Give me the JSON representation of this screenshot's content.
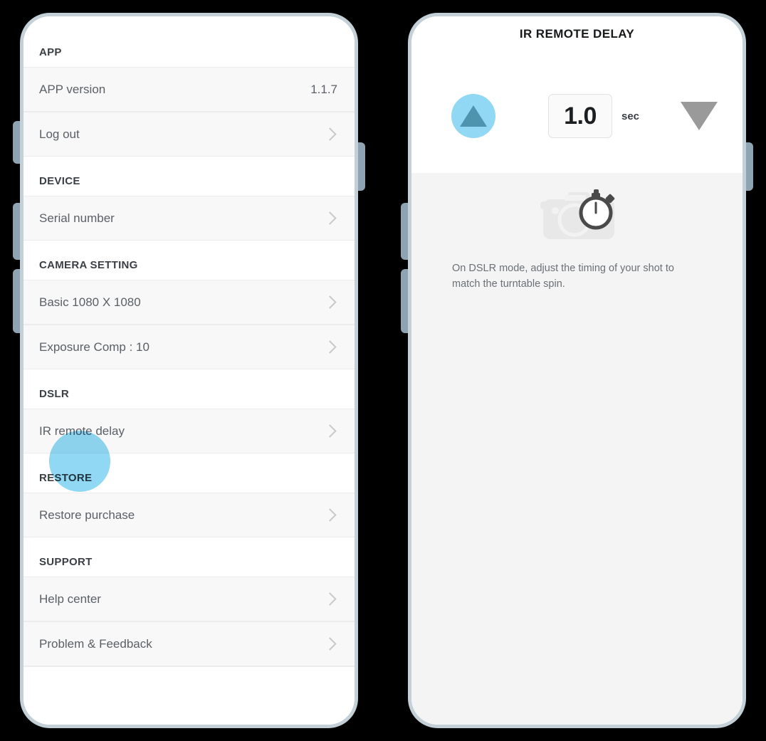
{
  "left_screen": {
    "sections": [
      {
        "header": "APP",
        "rows": [
          {
            "label": "APP version",
            "value": "1.1.7",
            "chevron": false
          },
          {
            "label": "Log out",
            "value": "",
            "chevron": true
          }
        ]
      },
      {
        "header": "DEVICE",
        "rows": [
          {
            "label": "Serial number",
            "value": "",
            "chevron": true
          }
        ]
      },
      {
        "header": "CAMERA SETTING",
        "rows": [
          {
            "label": "Basic 1080 X 1080",
            "value": "",
            "chevron": true
          },
          {
            "label": "Exposure Comp : 10",
            "value": "",
            "chevron": true
          }
        ]
      },
      {
        "header": "DSLR",
        "rows": [
          {
            "label": "IR remote delay",
            "value": "",
            "chevron": true
          }
        ]
      },
      {
        "header": "RESTORE",
        "rows": [
          {
            "label": "Restore purchase",
            "value": "",
            "chevron": true
          }
        ]
      },
      {
        "header": "SUPPORT",
        "rows": [
          {
            "label": "Help center",
            "value": "",
            "chevron": true
          },
          {
            "label": "Problem & Feedback",
            "value": "",
            "chevron": true
          }
        ]
      }
    ]
  },
  "right_screen": {
    "title": "IR REMOTE DELAY",
    "stepper": {
      "increase_icon": "triangle-up-icon",
      "decrease_icon": "triangle-down-icon",
      "value": "1.0",
      "unit": "sec"
    },
    "hero_icon": "camera-stopwatch-icon",
    "description": "On DSLR mode, adjust the timing of your shot to match the turntable spin."
  },
  "colors": {
    "touch_highlight": "#90d8f4",
    "up_arrow": "#4f94ae",
    "down_arrow": "#9a9a9a",
    "frame": "#c3d0d8",
    "side_button": "#8fa4b3",
    "row_bg": "#f8f8f8",
    "body_bg": "#f4f4f4",
    "background": "#000000"
  }
}
